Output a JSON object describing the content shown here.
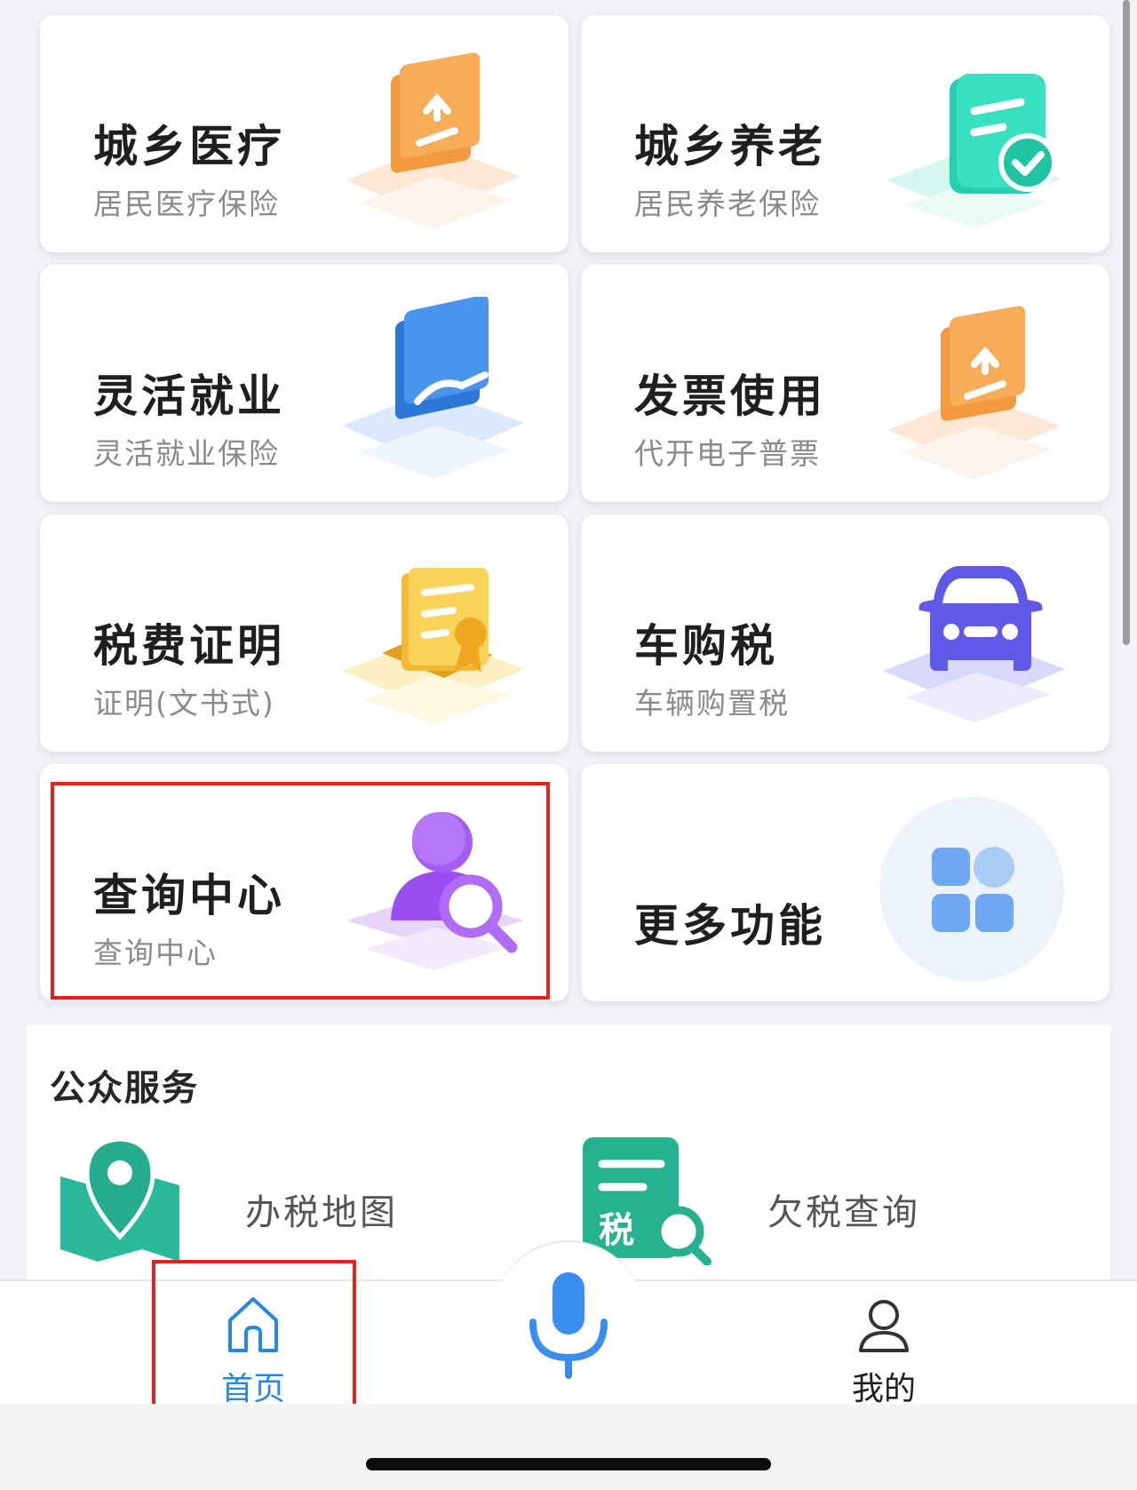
{
  "cards": [
    {
      "title": "城乡医疗",
      "subtitle": "居民医疗保险",
      "icon": "upload-folder-icon",
      "accent": "#f5a04a"
    },
    {
      "title": "城乡养老",
      "subtitle": "居民养老保险",
      "icon": "document-check-icon",
      "accent": "#2ed3b3"
    },
    {
      "title": "灵活就业",
      "subtitle": "灵活就业保险",
      "icon": "blue-folder-icon",
      "accent": "#3f8ff0"
    },
    {
      "title": "发票使用",
      "subtitle": "代开电子普票",
      "icon": "upload-folder-icon",
      "accent": "#f5a04a"
    },
    {
      "title": "税费证明",
      "subtitle": "证明(文书式)",
      "icon": "certificate-icon",
      "accent": "#f6c343"
    },
    {
      "title": "车购税",
      "subtitle": "车辆购置税",
      "icon": "car-icon",
      "accent": "#6b63f0"
    },
    {
      "title": "查询中心",
      "subtitle": "查询中心",
      "icon": "user-search-icon",
      "accent": "#a45cf5"
    },
    {
      "title": "更多功能",
      "subtitle": "",
      "icon": "grid-apps-icon",
      "accent": "#6aa6f2"
    }
  ],
  "public_services": {
    "title": "公众服务",
    "items": [
      {
        "label": "办税地图",
        "icon": "map-pin-icon",
        "accent": "#27b48d"
      },
      {
        "label": "欠税查询",
        "icon": "tax-search-icon",
        "accent": "#27b48d",
        "badge": "税"
      }
    ]
  },
  "tabbar": {
    "home_label": "首页",
    "mine_label": "我的",
    "active_color": "#2a86e6",
    "voice": "microphone-icon"
  }
}
